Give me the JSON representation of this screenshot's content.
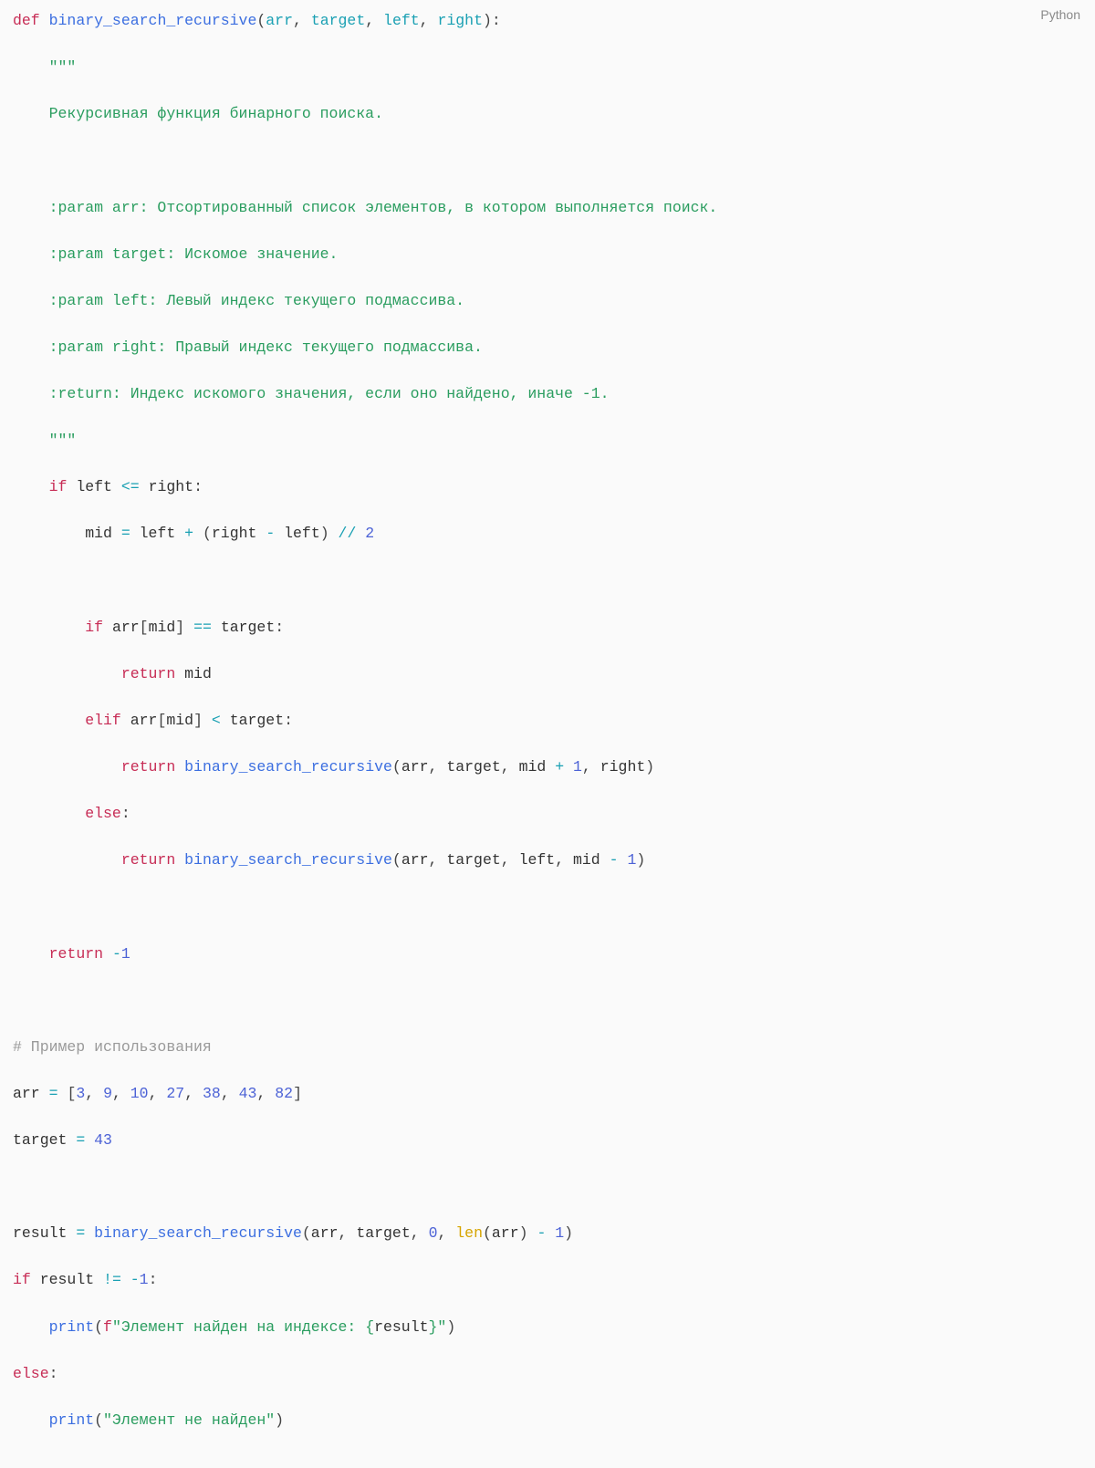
{
  "language_label": "Python",
  "code": {
    "l01": {
      "def": "def",
      "fn": "binary_search_recursive",
      "p1": "arr",
      "p2": "target",
      "p3": "left",
      "p4": "right"
    },
    "l02": {
      "q": "\"\"\""
    },
    "l03": {
      "t": "Рекурсивная функция бинарного поиска."
    },
    "l05": {
      "t": ":param arr: Отсортированный список элементов, в котором выполняется поиск."
    },
    "l06": {
      "t": ":param target: Искомое значение."
    },
    "l07": {
      "t": ":param left: Левый индекс текущего подмассива."
    },
    "l08": {
      "t": ":param right: Правый индекс текущего подмассива."
    },
    "l09": {
      "t": ":return: Индекс искомого значения, если оно найдено, иначе -1."
    },
    "l10": {
      "q": "\"\"\""
    },
    "l11": {
      "if": "if",
      "left": "left",
      "le": "<=",
      "right": "right"
    },
    "l12": {
      "mid": "mid",
      "eq": "=",
      "left": "left",
      "plus": "+",
      "rp": "right",
      "minus": "-",
      "lf": "left",
      "fd": "//",
      "two": "2"
    },
    "l14": {
      "if": "if",
      "arr": "arr",
      "mid": "mid",
      "eq": "==",
      "tgt": "target"
    },
    "l15": {
      "ret": "return",
      "mid": "mid"
    },
    "l16": {
      "elif": "elif",
      "arr": "arr",
      "mid": "mid",
      "lt": "<",
      "tgt": "target"
    },
    "l17": {
      "ret": "return",
      "fn": "binary_search_recursive",
      "arr": "arr",
      "tgt": "target",
      "mid": "mid",
      "plus": "+",
      "one": "1",
      "right": "right"
    },
    "l18": {
      "else": "else"
    },
    "l19": {
      "ret": "return",
      "fn": "binary_search_recursive",
      "arr": "arr",
      "tgt": "target",
      "left": "left",
      "mid": "mid",
      "minus": "-",
      "one": "1"
    },
    "l21": {
      "ret": "return",
      "minus": "-",
      "one": "1"
    },
    "l23": {
      "c": "# Пример использования"
    },
    "l24": {
      "arr": "arr",
      "eq": "=",
      "v0": "3",
      "v1": "9",
      "v2": "10",
      "v3": "27",
      "v4": "38",
      "v5": "43",
      "v6": "82"
    },
    "l25": {
      "tgt": "target",
      "eq": "=",
      "v": "43"
    },
    "l27": {
      "res": "result",
      "eq": "=",
      "fn": "binary_search_recursive",
      "arr": "arr",
      "tgt": "target",
      "zero": "0",
      "len": "len",
      "arr2": "arr",
      "minus": "-",
      "one": "1"
    },
    "l28": {
      "if": "if",
      "res": "result",
      "ne": "!=",
      "minus": "-",
      "one": "1"
    },
    "l29": {
      "print": "print",
      "f": "f",
      "s1": "\"Элемент найден на индексе: ",
      "lb": "{",
      "res": "result",
      "rb": "}",
      "s2": "\""
    },
    "l30": {
      "else": "else"
    },
    "l31": {
      "print": "print",
      "s": "\"Элемент не найден\""
    }
  }
}
